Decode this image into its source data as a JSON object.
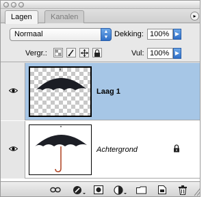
{
  "tabs": [
    {
      "label": "Lagen"
    },
    {
      "label": "Kanalen"
    }
  ],
  "blend_mode": {
    "value": "Normaal"
  },
  "opacity": {
    "label": "Dekking:",
    "value": "100%"
  },
  "lock": {
    "label": "Vergr.:"
  },
  "fill": {
    "label": "Vul:",
    "value": "100%"
  },
  "layers": [
    {
      "name": "Laag 1",
      "selected": true
    },
    {
      "name": "Achtergrond",
      "selected": false
    }
  ],
  "colors": {
    "selection": "#a6c6e6",
    "accent_blue": "#2f6fc7"
  }
}
